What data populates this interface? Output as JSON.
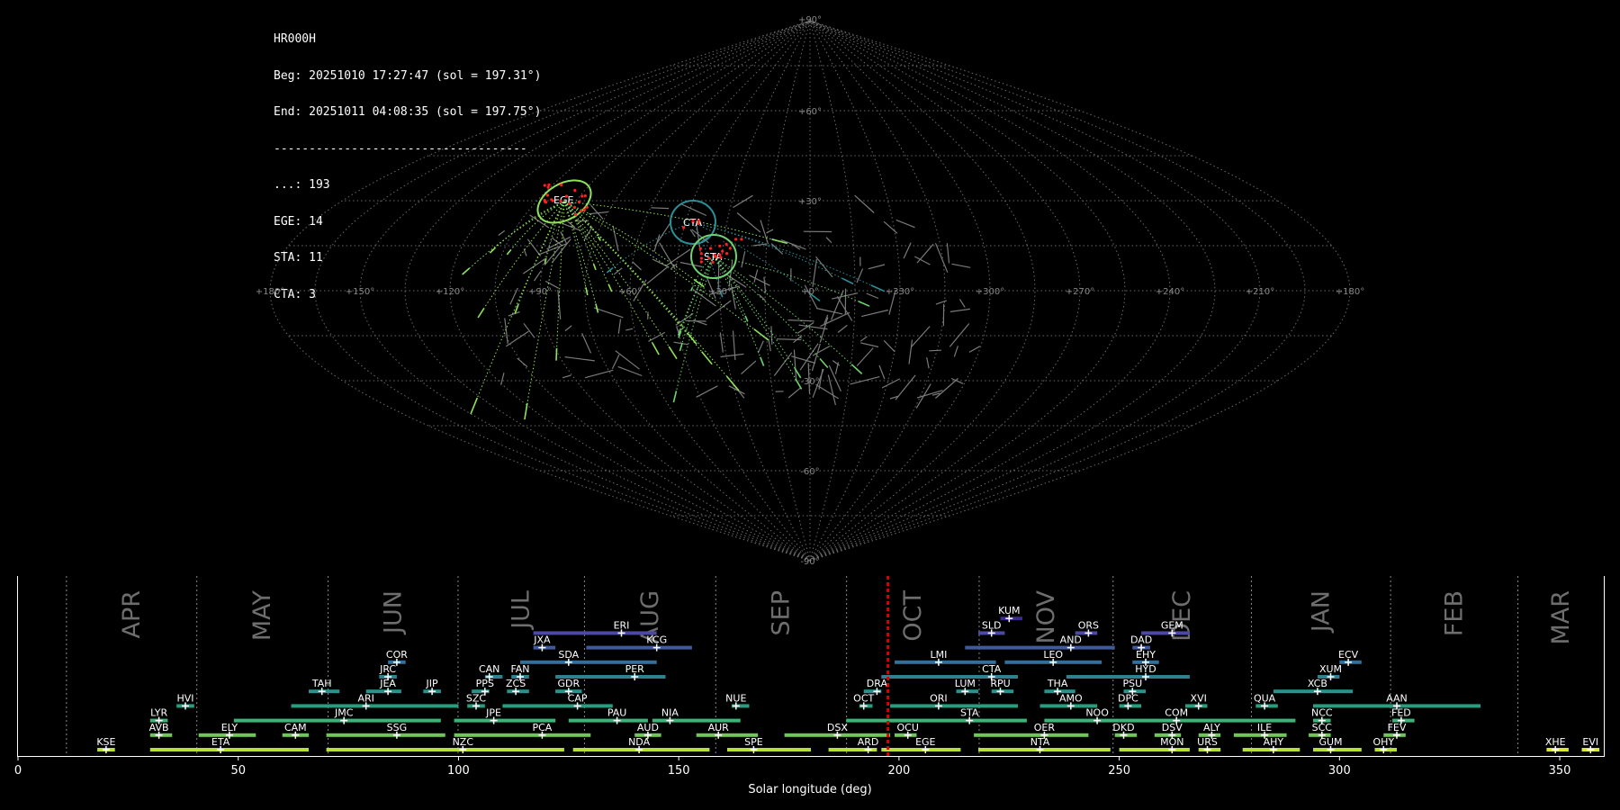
{
  "info": {
    "station": "HR000H",
    "beg": "Beg: 20251010 17:27:47 (sol = 197.31°)",
    "end": "End: 20251011 04:08:35 (sol = 197.75°)",
    "separator": "------------------------------------",
    "counts": [
      {
        "text": "...: 193"
      },
      {
        "text": "EGE: 14"
      },
      {
        "text": "STA: 11"
      },
      {
        "text": "CTA: 3"
      }
    ]
  },
  "sky_map": {
    "ra_labels": [
      "+180°",
      "+150°",
      "+120°",
      "+90°",
      "+60°",
      "+30°",
      "+0°",
      "+330°",
      "+300°",
      "+270°",
      "+240°",
      "+210°",
      "+180°"
    ],
    "dec_labels": [
      "+90°",
      "+60°",
      "+30°",
      "-30°",
      "-60°",
      "-90°"
    ],
    "showers": [
      {
        "code": "EGE",
        "color": "#8fe35a"
      },
      {
        "code": "CTA",
        "color": "#2b8f98"
      },
      {
        "code": "STA",
        "color": "#6fd270"
      }
    ],
    "colors": {
      "grid": "#6a6a6a",
      "sporadic": "#7a7a7a",
      "radiant": "#ff2020"
    }
  },
  "chart_data": {
    "type": "timeline",
    "xlabel": "Solar longitude (deg)",
    "xlim": [
      0,
      360
    ],
    "xticks": [
      0,
      50,
      100,
      150,
      200,
      250,
      300,
      350
    ],
    "current_sol": 197.5,
    "months": [
      {
        "name": "APR",
        "boundary": 11.0
      },
      {
        "name": "MAY",
        "boundary": 40.6
      },
      {
        "name": "JUN",
        "boundary": 70.4
      },
      {
        "name": "JUL",
        "boundary": 99.9
      },
      {
        "name": "AUG",
        "boundary": 128.6
      },
      {
        "name": "SEP",
        "boundary": 158.4
      },
      {
        "name": "OCT",
        "boundary": 188.1
      },
      {
        "name": "NOV",
        "boundary": 218.2
      },
      {
        "name": "DEC",
        "boundary": 248.6
      },
      {
        "name": "JAN",
        "boundary": 280.0
      },
      {
        "name": "FEB",
        "boundary": 311.6
      },
      {
        "name": "MAR",
        "boundary": 340.5
      }
    ],
    "showers": [
      {
        "code": "KUM",
        "row": 9,
        "start": 223,
        "end": 228,
        "peak": 225,
        "color": "#3b2a8a"
      },
      {
        "code": "ERI",
        "row": 8,
        "start": 117,
        "end": 145,
        "peak": 137,
        "color": "#4b4aa0"
      },
      {
        "code": "SLD",
        "row": 8,
        "start": 218,
        "end": 224,
        "peak": 221,
        "color": "#4b4aa0"
      },
      {
        "code": "ORS",
        "row": 8,
        "start": 240,
        "end": 245,
        "peak": 243,
        "color": "#4b4aa0"
      },
      {
        "code": "GEM",
        "row": 8,
        "start": 255,
        "end": 266,
        "peak": 262,
        "color": "#4b4aa0"
      },
      {
        "code": "JXA",
        "row": 7,
        "start": 117,
        "end": 122,
        "peak": 119,
        "color": "#3f5b9a"
      },
      {
        "code": "KCG",
        "row": 7,
        "start": 129,
        "end": 153,
        "peak": 145,
        "color": "#3f5b9a"
      },
      {
        "code": "AND",
        "row": 7,
        "start": 215,
        "end": 249,
        "peak": 239,
        "color": "#3f5b9a"
      },
      {
        "code": "DAD",
        "row": 7,
        "start": 253,
        "end": 257,
        "peak": 255,
        "color": "#3f5b9a"
      },
      {
        "code": "COR",
        "row": 6,
        "start": 84,
        "end": 88,
        "peak": 86,
        "color": "#356e97"
      },
      {
        "code": "SDA",
        "row": 6,
        "start": 114,
        "end": 145,
        "peak": 125,
        "color": "#356e97"
      },
      {
        "code": "LMI",
        "row": 6,
        "start": 199,
        "end": 222,
        "peak": 209,
        "color": "#356e97"
      },
      {
        "code": "LEO",
        "row": 6,
        "start": 224,
        "end": 246,
        "peak": 235,
        "color": "#356e97"
      },
      {
        "code": "EHY",
        "row": 6,
        "start": 253,
        "end": 259,
        "peak": 256,
        "color": "#356e97"
      },
      {
        "code": "ECV",
        "row": 6,
        "start": 300,
        "end": 305,
        "peak": 302,
        "color": "#356e97"
      },
      {
        "code": "JRC",
        "row": 5,
        "start": 82,
        "end": 86,
        "peak": 84,
        "color": "#2f8190"
      },
      {
        "code": "CAN",
        "row": 5,
        "start": 106,
        "end": 110,
        "peak": 107,
        "color": "#2f8190"
      },
      {
        "code": "FAN",
        "row": 5,
        "start": 112,
        "end": 116,
        "peak": 114,
        "color": "#2f8190"
      },
      {
        "code": "PER",
        "row": 5,
        "start": 122,
        "end": 147,
        "peak": 140,
        "color": "#2f8190"
      },
      {
        "code": "CTA",
        "row": 5,
        "start": 196,
        "end": 227,
        "peak": 221,
        "color": "#2f8190"
      },
      {
        "code": "HYD",
        "row": 5,
        "start": 238,
        "end": 266,
        "peak": 256,
        "color": "#2f8190"
      },
      {
        "code": "XUM",
        "row": 5,
        "start": 295,
        "end": 300,
        "peak": 298,
        "color": "#2f8190"
      },
      {
        "code": "TAH",
        "row": 4,
        "start": 66,
        "end": 73,
        "peak": 69,
        "color": "#28928b"
      },
      {
        "code": "JEA",
        "row": 4,
        "start": 79,
        "end": 87,
        "peak": 84,
        "color": "#28928b"
      },
      {
        "code": "JIP",
        "row": 4,
        "start": 92,
        "end": 96,
        "peak": 94,
        "color": "#28928b"
      },
      {
        "code": "PPS",
        "row": 4,
        "start": 103,
        "end": 107,
        "peak": 106,
        "color": "#28928b"
      },
      {
        "code": "ZCS",
        "row": 4,
        "start": 111,
        "end": 116,
        "peak": 113,
        "color": "#28928b"
      },
      {
        "code": "GDR",
        "row": 4,
        "start": 122,
        "end": 128,
        "peak": 125,
        "color": "#28928b"
      },
      {
        "code": "DRA",
        "row": 4,
        "start": 192,
        "end": 196,
        "peak": 195,
        "color": "#28928b"
      },
      {
        "code": "LUM",
        "row": 4,
        "start": 213,
        "end": 218,
        "peak": 215,
        "color": "#28928b"
      },
      {
        "code": "RPU",
        "row": 4,
        "start": 221,
        "end": 226,
        "peak": 223,
        "color": "#28928b"
      },
      {
        "code": "THA",
        "row": 4,
        "start": 233,
        "end": 240,
        "peak": 236,
        "color": "#28928b"
      },
      {
        "code": "PSU",
        "row": 4,
        "start": 251,
        "end": 256,
        "peak": 253,
        "color": "#28928b"
      },
      {
        "code": "XCB",
        "row": 4,
        "start": 285,
        "end": 303,
        "peak": 295,
        "color": "#28928b"
      },
      {
        "code": "HVI",
        "row": 3,
        "start": 36,
        "end": 40,
        "peak": 38,
        "color": "#22a17f"
      },
      {
        "code": "ARI",
        "row": 3,
        "start": 62,
        "end": 100,
        "peak": 79,
        "color": "#22a17f"
      },
      {
        "code": "SZC",
        "row": 3,
        "start": 102,
        "end": 106,
        "peak": 104,
        "color": "#22a17f"
      },
      {
        "code": "CAP",
        "row": 3,
        "start": 110,
        "end": 135,
        "peak": 127,
        "color": "#22a17f"
      },
      {
        "code": "NUE",
        "row": 3,
        "start": 162,
        "end": 166,
        "peak": 163,
        "color": "#22a17f"
      },
      {
        "code": "OCT",
        "row": 3,
        "start": 191,
        "end": 194,
        "peak": 192,
        "color": "#22a17f"
      },
      {
        "code": "ORI",
        "row": 3,
        "start": 198,
        "end": 227,
        "peak": 209,
        "color": "#22a17f"
      },
      {
        "code": "AMO",
        "row": 3,
        "start": 232,
        "end": 245,
        "peak": 239,
        "color": "#22a17f"
      },
      {
        "code": "DPC",
        "row": 3,
        "start": 250,
        "end": 255,
        "peak": 252,
        "color": "#22a17f"
      },
      {
        "code": "XVI",
        "row": 3,
        "start": 265,
        "end": 270,
        "peak": 268,
        "color": "#22a17f"
      },
      {
        "code": "QUA",
        "row": 3,
        "start": 281,
        "end": 286,
        "peak": 283,
        "color": "#22a17f"
      },
      {
        "code": "AAN",
        "row": 3,
        "start": 294,
        "end": 332,
        "peak": 313,
        "color": "#22a17f"
      },
      {
        "code": "LYR",
        "row": 2,
        "start": 30,
        "end": 34,
        "peak": 32,
        "color": "#3ab57a"
      },
      {
        "code": "JMC",
        "row": 2,
        "start": 49,
        "end": 96,
        "peak": 74,
        "color": "#3ab57a"
      },
      {
        "code": "JPE",
        "row": 2,
        "start": 99,
        "end": 122,
        "peak": 108,
        "color": "#3ab57a"
      },
      {
        "code": "PAU",
        "row": 2,
        "start": 125,
        "end": 143,
        "peak": 136,
        "color": "#3ab57a"
      },
      {
        "code": "NIA",
        "row": 2,
        "start": 144,
        "end": 164,
        "peak": 148,
        "color": "#3ab57a"
      },
      {
        "code": "STA",
        "row": 2,
        "start": 188,
        "end": 229,
        "peak": 216,
        "color": "#3ab57a"
      },
      {
        "code": "NOO",
        "row": 2,
        "start": 233,
        "end": 250,
        "peak": 245,
        "color": "#3ab57a"
      },
      {
        "code": "COM",
        "row": 2,
        "start": 250,
        "end": 290,
        "peak": 263,
        "color": "#3ab57a"
      },
      {
        "code": "NCC",
        "row": 2,
        "start": 294,
        "end": 298,
        "peak": 296,
        "color": "#3ab57a"
      },
      {
        "code": "FED",
        "row": 2,
        "start": 312,
        "end": 317,
        "peak": 314,
        "color": "#3ab57a"
      },
      {
        "code": "AVB",
        "row": 1,
        "start": 30,
        "end": 35,
        "peak": 32,
        "color": "#6fc75a"
      },
      {
        "code": "ELY",
        "row": 1,
        "start": 41,
        "end": 54,
        "peak": 48,
        "color": "#6fc75a"
      },
      {
        "code": "CAM",
        "row": 1,
        "start": 60,
        "end": 66,
        "peak": 63,
        "color": "#6fc75a"
      },
      {
        "code": "SSG",
        "row": 1,
        "start": 70,
        "end": 97,
        "peak": 86,
        "color": "#6fc75a"
      },
      {
        "code": "PCA",
        "row": 1,
        "start": 99,
        "end": 130,
        "peak": 119,
        "color": "#6fc75a"
      },
      {
        "code": "AUD",
        "row": 1,
        "start": 140,
        "end": 146,
        "peak": 143,
        "color": "#6fc75a"
      },
      {
        "code": "AUR",
        "row": 1,
        "start": 154,
        "end": 168,
        "peak": 159,
        "color": "#6fc75a"
      },
      {
        "code": "DSX",
        "row": 1,
        "start": 174,
        "end": 198,
        "peak": 186,
        "color": "#6fc75a"
      },
      {
        "code": "OCU",
        "row": 1,
        "start": 199,
        "end": 204,
        "peak": 202,
        "color": "#6fc75a"
      },
      {
        "code": "OER",
        "row": 1,
        "start": 217,
        "end": 243,
        "peak": 233,
        "color": "#6fc75a"
      },
      {
        "code": "DKD",
        "row": 1,
        "start": 249,
        "end": 254,
        "peak": 251,
        "color": "#6fc75a"
      },
      {
        "code": "DSV",
        "row": 1,
        "start": 258,
        "end": 264,
        "peak": 262,
        "color": "#6fc75a"
      },
      {
        "code": "ALY",
        "row": 1,
        "start": 268,
        "end": 273,
        "peak": 271,
        "color": "#6fc75a"
      },
      {
        "code": "ILE",
        "row": 1,
        "start": 276,
        "end": 288,
        "peak": 283,
        "color": "#6fc75a"
      },
      {
        "code": "SCC",
        "row": 1,
        "start": 293,
        "end": 298,
        "peak": 296,
        "color": "#6fc75a"
      },
      {
        "code": "FEV",
        "row": 1,
        "start": 310,
        "end": 315,
        "peak": 313,
        "color": "#6fc75a"
      },
      {
        "code": "KSE",
        "row": 0,
        "start": 18,
        "end": 22,
        "peak": 20,
        "color": "#b7df3c"
      },
      {
        "code": "ETA",
        "row": 0,
        "start": 30,
        "end": 66,
        "peak": 46,
        "color": "#b7df3c"
      },
      {
        "code": "NZC",
        "row": 0,
        "start": 70,
        "end": 124,
        "peak": 101,
        "color": "#b7df3c"
      },
      {
        "code": "NDA",
        "row": 0,
        "start": 126,
        "end": 157,
        "peak": 141,
        "color": "#b7df3c"
      },
      {
        "code": "SPE",
        "row": 0,
        "start": 161,
        "end": 180,
        "peak": 167,
        "color": "#b7df3c"
      },
      {
        "code": "ARD",
        "row": 0,
        "start": 184,
        "end": 195,
        "peak": 193,
        "color": "#b7df3c"
      },
      {
        "code": "EGE",
        "row": 0,
        "start": 196,
        "end": 214,
        "peak": 206,
        "color": "#b7df3c"
      },
      {
        "code": "NTA",
        "row": 0,
        "start": 218,
        "end": 248,
        "peak": 232,
        "color": "#b7df3c"
      },
      {
        "code": "MON",
        "row": 0,
        "start": 250,
        "end": 266,
        "peak": 262,
        "color": "#b7df3c"
      },
      {
        "code": "URS",
        "row": 0,
        "start": 268,
        "end": 273,
        "peak": 270,
        "color": "#b7df3c"
      },
      {
        "code": "AHY",
        "row": 0,
        "start": 278,
        "end": 291,
        "peak": 285,
        "color": "#b7df3c"
      },
      {
        "code": "GUM",
        "row": 0,
        "start": 294,
        "end": 305,
        "peak": 298,
        "color": "#b7df3c"
      },
      {
        "code": "OHY",
        "row": 0,
        "start": 308,
        "end": 313,
        "peak": 310,
        "color": "#b7df3c"
      },
      {
        "code": "XHE",
        "row": 0,
        "start": 347,
        "end": 352,
        "peak": 349,
        "color": "#d9e63a"
      },
      {
        "code": "EVI",
        "row": 0,
        "start": 355,
        "end": 359,
        "peak": 357,
        "color": "#d9e63a"
      }
    ]
  }
}
